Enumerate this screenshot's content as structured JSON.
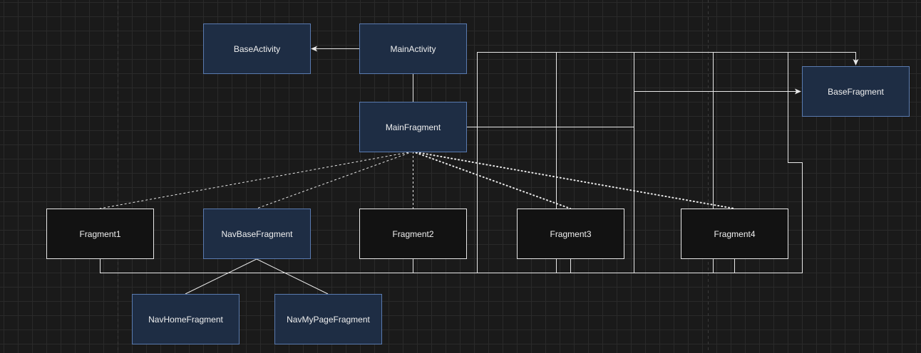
{
  "diagram": {
    "nodes": [
      {
        "id": "base-activity",
        "label": "BaseActivity",
        "style": "blue"
      },
      {
        "id": "main-activity",
        "label": "MainActivity",
        "style": "blue"
      },
      {
        "id": "main-fragment",
        "label": "MainFragment",
        "style": "blue"
      },
      {
        "id": "base-fragment",
        "label": "BaseFragment",
        "style": "blue"
      },
      {
        "id": "fragment1",
        "label": "Fragment1",
        "style": "dark"
      },
      {
        "id": "nav-base-fragment",
        "label": "NavBaseFragment",
        "style": "blue"
      },
      {
        "id": "fragment2",
        "label": "Fragment2",
        "style": "dark"
      },
      {
        "id": "fragment3",
        "label": "Fragment3",
        "style": "dark"
      },
      {
        "id": "fragment4",
        "label": "Fragment4",
        "style": "dark"
      },
      {
        "id": "nav-home-fragment",
        "label": "NavHomeFragment",
        "style": "blue"
      },
      {
        "id": "nav-my-page-fragment",
        "label": "NavMyPageFragment",
        "style": "blue"
      }
    ],
    "edges": [
      {
        "from": "main-activity",
        "to": "base-activity",
        "style": "solid-arrow"
      },
      {
        "from": "main-activity",
        "to": "main-fragment",
        "style": "solid"
      },
      {
        "from": "main-fragment",
        "to": "base-fragment",
        "style": "solid-arrow"
      },
      {
        "from": "main-fragment",
        "to": "fragment1",
        "style": "dashed"
      },
      {
        "from": "main-fragment",
        "to": "nav-base-fragment",
        "style": "dashed"
      },
      {
        "from": "main-fragment",
        "to": "fragment2",
        "style": "dashed"
      },
      {
        "from": "main-fragment",
        "to": "fragment3",
        "style": "dotted"
      },
      {
        "from": "main-fragment",
        "to": "fragment4",
        "style": "dotted"
      },
      {
        "from": "nav-base-fragment",
        "to": "nav-home-fragment",
        "style": "solid"
      },
      {
        "from": "nav-base-fragment",
        "to": "nav-my-page-fragment",
        "style": "solid"
      },
      {
        "from": "fragment1",
        "to": "base-fragment",
        "style": "solid-arrow"
      },
      {
        "from": "fragment2",
        "to": "base-fragment",
        "style": "solid-arrow"
      },
      {
        "from": "fragment3",
        "to": "base-fragment",
        "style": "solid-arrow"
      },
      {
        "from": "fragment4",
        "to": "base-fragment",
        "style": "solid-arrow"
      }
    ]
  },
  "colors": {
    "background": "#1a1a1a",
    "grid": "#2a2a2a",
    "edge": "#e8e8e8",
    "blue_fill": "#1e2d44",
    "blue_stroke": "#5a7bb0",
    "dark_fill": "#121212",
    "dark_stroke": "#e8e8e8"
  }
}
